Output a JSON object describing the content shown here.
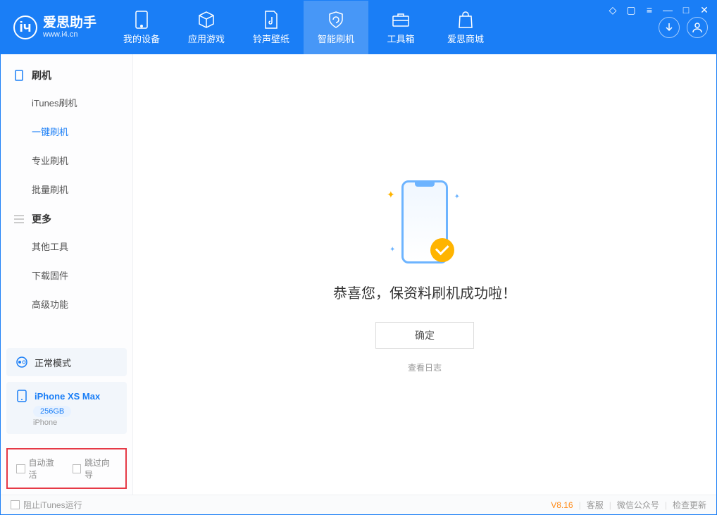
{
  "logo": {
    "title": "爱思助手",
    "subtitle": "www.i4.cn"
  },
  "tabs": [
    {
      "label": "我的设备"
    },
    {
      "label": "应用游戏"
    },
    {
      "label": "铃声壁纸"
    },
    {
      "label": "智能刷机"
    },
    {
      "label": "工具箱"
    },
    {
      "label": "爱思商城"
    }
  ],
  "sidebar": {
    "group1": {
      "title": "刷机",
      "items": [
        "iTunes刷机",
        "一键刷机",
        "专业刷机",
        "批量刷机"
      ]
    },
    "group2": {
      "title": "更多",
      "items": [
        "其他工具",
        "下载固件",
        "高级功能"
      ]
    }
  },
  "mode": {
    "label": "正常模式"
  },
  "device": {
    "name": "iPhone XS Max",
    "storage": "256GB",
    "type": "iPhone"
  },
  "checks": {
    "auto_activate": "自动激活",
    "skip_guide": "跳过向导"
  },
  "main": {
    "success": "恭喜您，保资料刷机成功啦！",
    "ok": "确定",
    "view_log": "查看日志"
  },
  "footer": {
    "block_itunes": "阻止iTunes运行",
    "version": "V8.16",
    "support": "客服",
    "wechat": "微信公众号",
    "update": "检查更新"
  }
}
